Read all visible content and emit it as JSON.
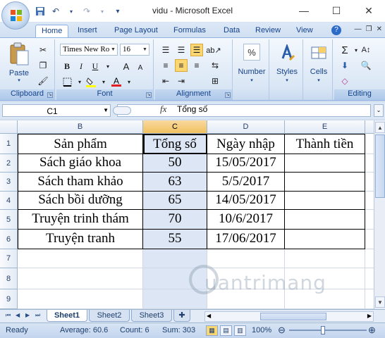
{
  "window": {
    "title": "vidu - Microsoft Excel"
  },
  "window_controls": {
    "minimize": "—",
    "maximize": "☐",
    "close": "✕"
  },
  "quick_access": {
    "save": "save-icon",
    "undo": "undo-icon",
    "redo": "redo-icon",
    "customize": "▾"
  },
  "tabs": [
    "Home",
    "Insert",
    "Page Layout",
    "Formulas",
    "Data",
    "Review",
    "View"
  ],
  "ribbon": {
    "clipboard": {
      "label": "Clipboard",
      "paste": "Paste"
    },
    "font": {
      "label": "Font",
      "font_name": "Times New Ro",
      "font_size": "16"
    },
    "alignment": {
      "label": "Alignment"
    },
    "number": {
      "label": "Number",
      "symbol": "%"
    },
    "styles": {
      "label": "Styles"
    },
    "cells": {
      "label": "Cells"
    },
    "editing": {
      "label": "Editing"
    }
  },
  "formula_bar": {
    "name_box": "C1",
    "fx": "fx",
    "content": "Tổng số"
  },
  "columns": [
    "B",
    "C",
    "D",
    "E"
  ],
  "rows": [
    "1",
    "2",
    "3",
    "4",
    "5",
    "6",
    "7",
    "8",
    "9"
  ],
  "table": {
    "headers": [
      "Sản phẩm",
      "Tổng số",
      "Ngày nhập",
      "Thành tiền"
    ],
    "rows": [
      [
        "Sách giáo khoa",
        "50",
        "15/05/2017",
        ""
      ],
      [
        "Sách tham khảo",
        "63",
        "5/5/2017",
        ""
      ],
      [
        "Sách bồi dưỡng",
        "65",
        "14/05/2017",
        ""
      ],
      [
        "Truyện trinh thám",
        "70",
        "10/6/2017",
        ""
      ],
      [
        "Truyện tranh",
        "55",
        "17/06/2017",
        ""
      ]
    ]
  },
  "sheets": [
    "Sheet1",
    "Sheet2",
    "Sheet3"
  ],
  "status": {
    "mode": "Ready",
    "average": "Average: 60.6",
    "count": "Count: 6",
    "sum": "Sum: 303",
    "zoom": "100%"
  },
  "watermark": "uantrimang",
  "colors": {
    "accent": "#15428b",
    "selected_header": "#f1c15f",
    "selected_column": "#dce6f4"
  }
}
